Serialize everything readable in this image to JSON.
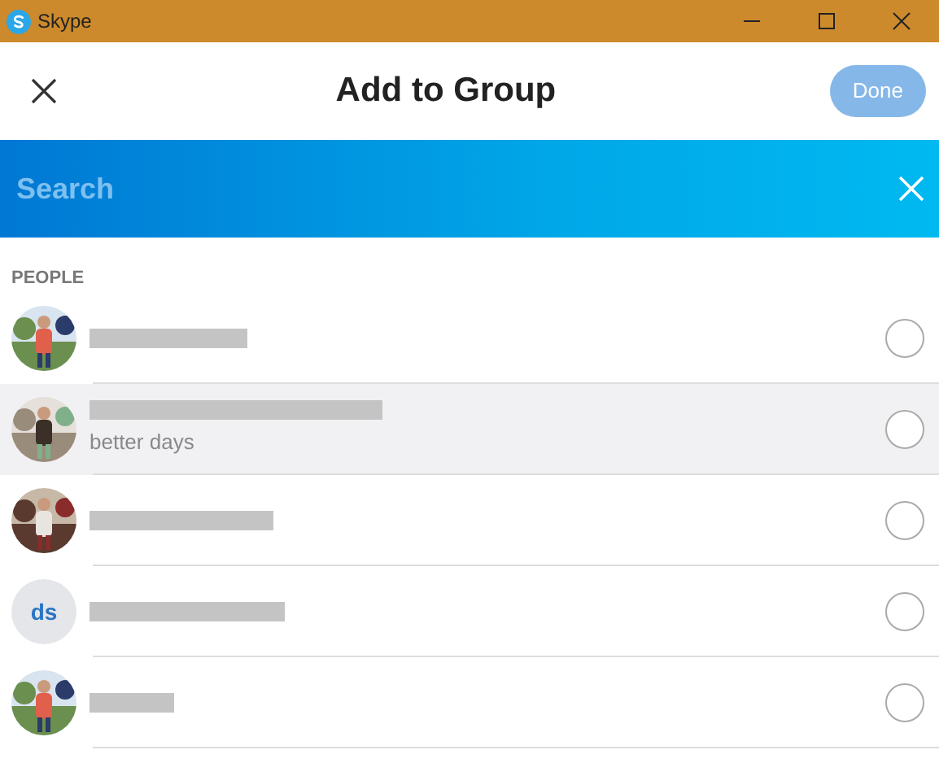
{
  "window": {
    "title": "Skype"
  },
  "header": {
    "title": "Add to Group",
    "done_button": {
      "label": "Done",
      "disabled": true
    }
  },
  "search": {
    "placeholder": "Search"
  },
  "section_label": "PEOPLE",
  "contacts": [
    {
      "highlighted": false,
      "checked": false
    },
    {
      "status": "better days",
      "highlighted": true,
      "checked": false
    },
    {
      "highlighted": false,
      "checked": false
    },
    {
      "avatar": {
        "kind": "initials",
        "initials": "ds"
      },
      "highlighted": false,
      "checked": false
    },
    {
      "highlighted": false,
      "checked": false
    }
  ]
}
